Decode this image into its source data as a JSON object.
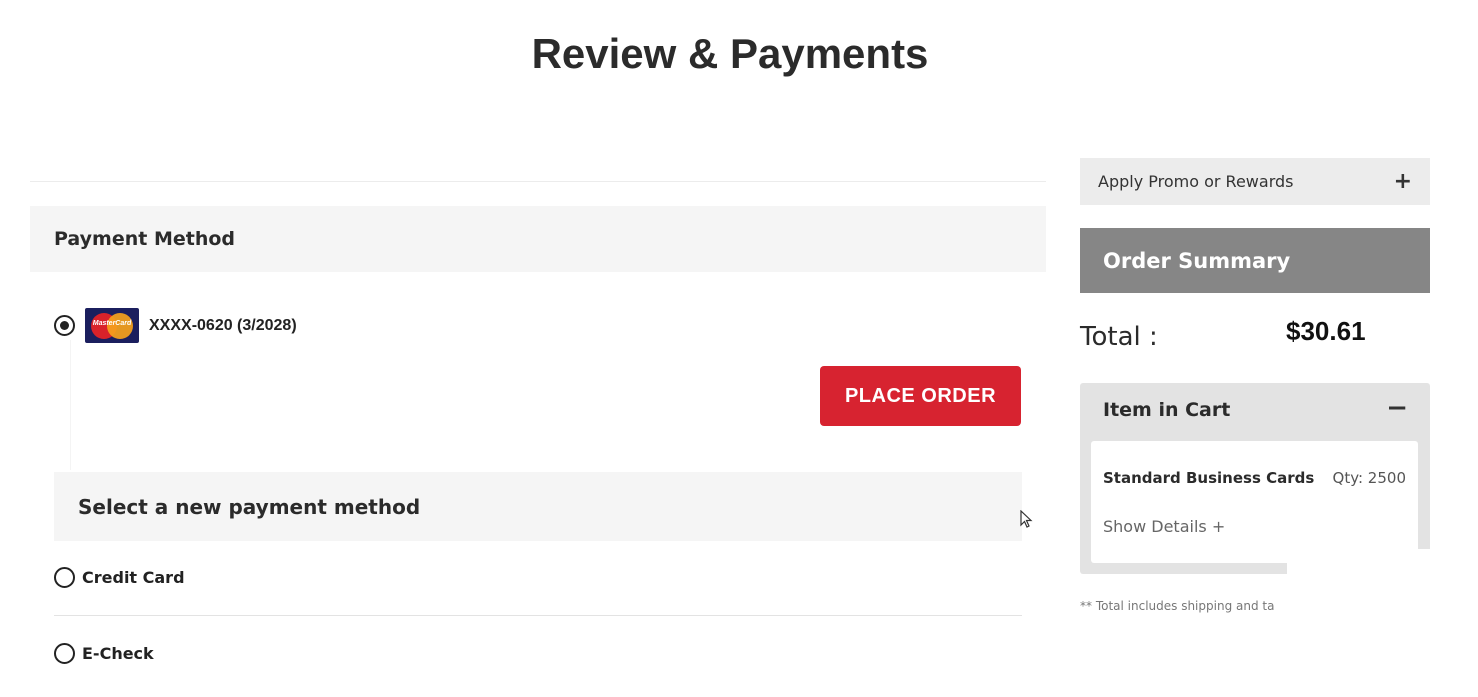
{
  "page": {
    "title": "Review & Payments"
  },
  "payment_method": {
    "heading": "Payment Method",
    "saved_card": {
      "brand": "MasterCard",
      "masked": "XXXX-0620 (3/2028)",
      "selected": true
    }
  },
  "place_order": {
    "label": "PLACE ORDER"
  },
  "new_payment": {
    "heading": "Select a new payment method",
    "options": [
      {
        "label": "Credit Card",
        "selected": false
      },
      {
        "label": "E-Check",
        "selected": false
      }
    ]
  },
  "sidebar": {
    "promo": {
      "label": "Apply Promo or Rewards",
      "toggle": "+"
    },
    "order_summary": {
      "heading": "Order Summary"
    },
    "total": {
      "label": "Total :",
      "value": "$30.61"
    },
    "cart": {
      "heading": "Item in Cart",
      "toggle": "−",
      "item": {
        "name": "Standard Business Cards",
        "qty": "Qty: 2500",
        "details_link": "Show Details +"
      }
    },
    "footnote": "** Total includes shipping and ta"
  },
  "colors": {
    "accent_red": "#d72330",
    "summary_grey": "#868686",
    "panel_grey": "#f5f5f5"
  },
  "icons": [
    "radio-icon",
    "mastercard-icon",
    "plus-icon",
    "minus-icon",
    "cursor-icon"
  ]
}
